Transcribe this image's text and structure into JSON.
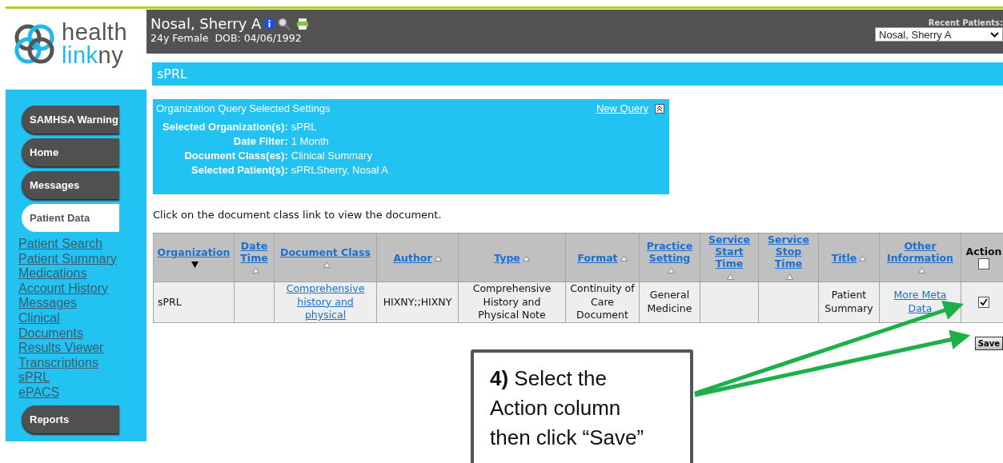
{
  "logo": {
    "top": "health",
    "bottom_start": "link",
    "bottom_end": "ny"
  },
  "patient": {
    "name": "Nosal, Sherry A",
    "details": "24y Female  DOB: 04/06/1992"
  },
  "recent_patients": {
    "label": "Recent Patients:",
    "value": "Nosal, Sherry A"
  },
  "sidebar": {
    "tabs": [
      {
        "label": "SAMHSA Warning",
        "selected": false
      },
      {
        "label": "Home",
        "selected": false
      },
      {
        "label": "Messages",
        "selected": false
      },
      {
        "label": "Patient Data",
        "selected": true,
        "links": [
          "Patient Search",
          "Patient Summary",
          "Medications",
          "Account History",
          "Messages",
          "Clinical Documents",
          "Results Viewer",
          "Transcriptions",
          "sPRL",
          "ePACS"
        ]
      },
      {
        "label": "Reports",
        "selected": false
      }
    ]
  },
  "page_title": "sPRL",
  "settings": {
    "title": "Organization Query Selected Settings",
    "link": "New Query",
    "expanded": true,
    "rows": [
      {
        "label": "Selected Organization(s):",
        "value": "sPRL"
      },
      {
        "label": "Date Filter:",
        "value": "1 Month"
      },
      {
        "label": "Document Class(es):",
        "value": "Clinical Summary"
      },
      {
        "label": "Selected Patient(s):",
        "value": "sPRLSherry, Nosal A"
      }
    ]
  },
  "instruction": "Click on the document class link to view the document.",
  "table": {
    "columns": [
      {
        "label": "Organization",
        "sorted_descending": true
      },
      {
        "label": "Date Time",
        "sorted_descending": false
      },
      {
        "label": "Document Class",
        "sorted_descending": false
      },
      {
        "label": "Author",
        "sorted_descending": false
      },
      {
        "label": "Type",
        "sorted_descending": false
      },
      {
        "label": "Format",
        "sorted_descending": false
      },
      {
        "label": "Practice Setting",
        "sorted_descending": false
      },
      {
        "label": "Service Start Time",
        "sorted_descending": false
      },
      {
        "label": "Service Stop Time",
        "sorted_descending": false
      },
      {
        "label": "Title",
        "sorted_descending": false
      },
      {
        "label": "Other Information",
        "sorted_descending": false
      },
      {
        "label": "Action",
        "kind": "checkbox",
        "checked": false
      }
    ],
    "rows": [
      [
        {
          "kind": "text",
          "text": "sPRL"
        },
        {
          "kind": "text",
          "text": ""
        },
        {
          "kind": "link",
          "text": "Comprehensive history and physical"
        },
        {
          "kind": "text",
          "text": "HIXNY;;HIXNY"
        },
        {
          "kind": "text",
          "text": "Comprehensive History and Physical Note"
        },
        {
          "kind": "text",
          "text": "Continuity of Care Document"
        },
        {
          "kind": "text",
          "text": "General Medicine"
        },
        {
          "kind": "text",
          "text": ""
        },
        {
          "kind": "text",
          "text": ""
        },
        {
          "kind": "text",
          "text": "Patient Summary"
        },
        {
          "kind": "link",
          "text": "More Meta Data"
        },
        {
          "kind": "checkbox",
          "checked": true
        }
      ]
    ]
  },
  "save_button": "Save",
  "callout": "**4)** Select the Action column then click “Save”"
}
